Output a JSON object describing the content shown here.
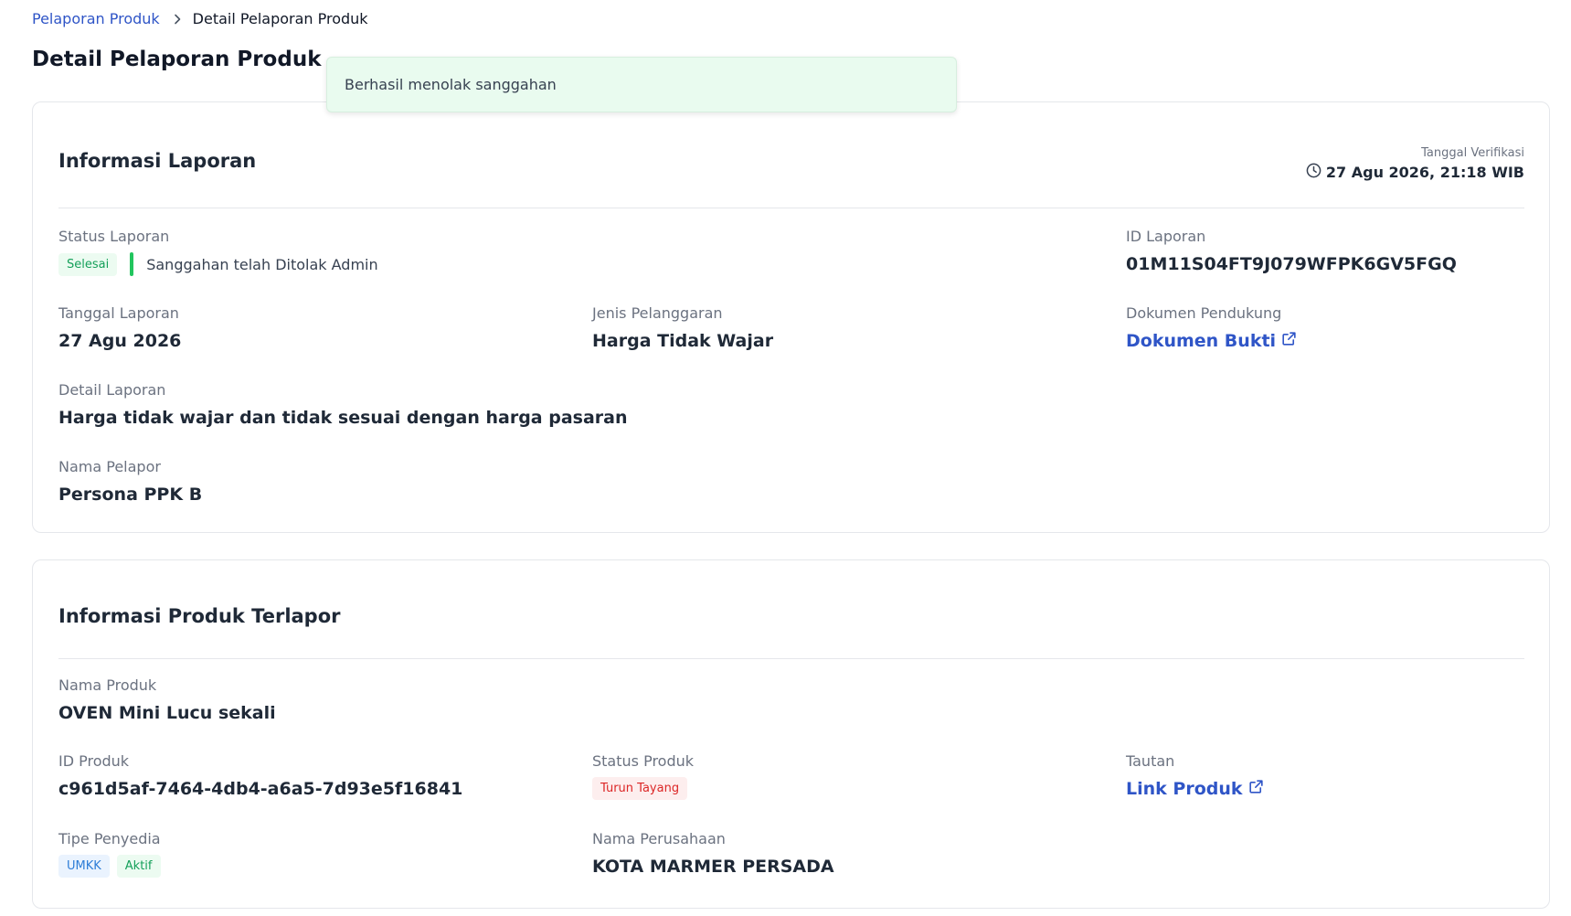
{
  "breadcrumb": {
    "parent": "Pelaporan Produk",
    "current": "Detail Pelaporan Produk"
  },
  "page_title": "Detail Pelaporan Produk",
  "toast": {
    "message": "Berhasil menolak sanggahan",
    "color": "#e9fbef"
  },
  "report_info": {
    "title": "Informasi Laporan",
    "verification_label": "Tanggal Verifikasi",
    "verification_value": "27 Agu 2026, 21:18 WIB",
    "status_label": "Status Laporan",
    "status_badge": "Selesai",
    "status_text": "Sanggahan telah Ditolak Admin",
    "id_label": "ID Laporan",
    "id_value": "01M11S04FT9J079WFPK6GV5FGQ",
    "date_label": "Tanggal Laporan",
    "date_value": "27 Agu 2026",
    "violation_label": "Jenis Pelanggaran",
    "violation_value": "Harga Tidak Wajar",
    "doc_label": "Dokumen Pendukung",
    "doc_link": "Dokumen Bukti",
    "detail_label": "Detail Laporan",
    "detail_value": "Harga tidak wajar dan tidak sesuai dengan harga pasaran",
    "reporter_label": "Nama Pelapor",
    "reporter_value": "Persona PPK B"
  },
  "product_info": {
    "title": "Informasi Produk Terlapor",
    "name_label": "Nama Produk",
    "name_value": "OVEN Mini Lucu sekali",
    "id_label": "ID Produk",
    "id_value": "c961d5af-7464-4db4-a6a5-7d93e5f16841",
    "status_label": "Status Produk",
    "status_badge": "Turun Tayang",
    "link_label": "Tautan",
    "link_text": "Link Produk",
    "provider_label": "Tipe Penyedia",
    "provider_badges": [
      "UMKK",
      "Aktif"
    ],
    "company_label": "Nama Perusahaan",
    "company_value": "KOTA MARMER PERSADA"
  },
  "colors": {
    "link": "#2f55c7",
    "success": "#15a05a",
    "danger": "#dc2626",
    "info": "#2e7dd7"
  },
  "icons": [
    "chevron-right-icon",
    "clock-icon",
    "external-link-icon"
  ]
}
